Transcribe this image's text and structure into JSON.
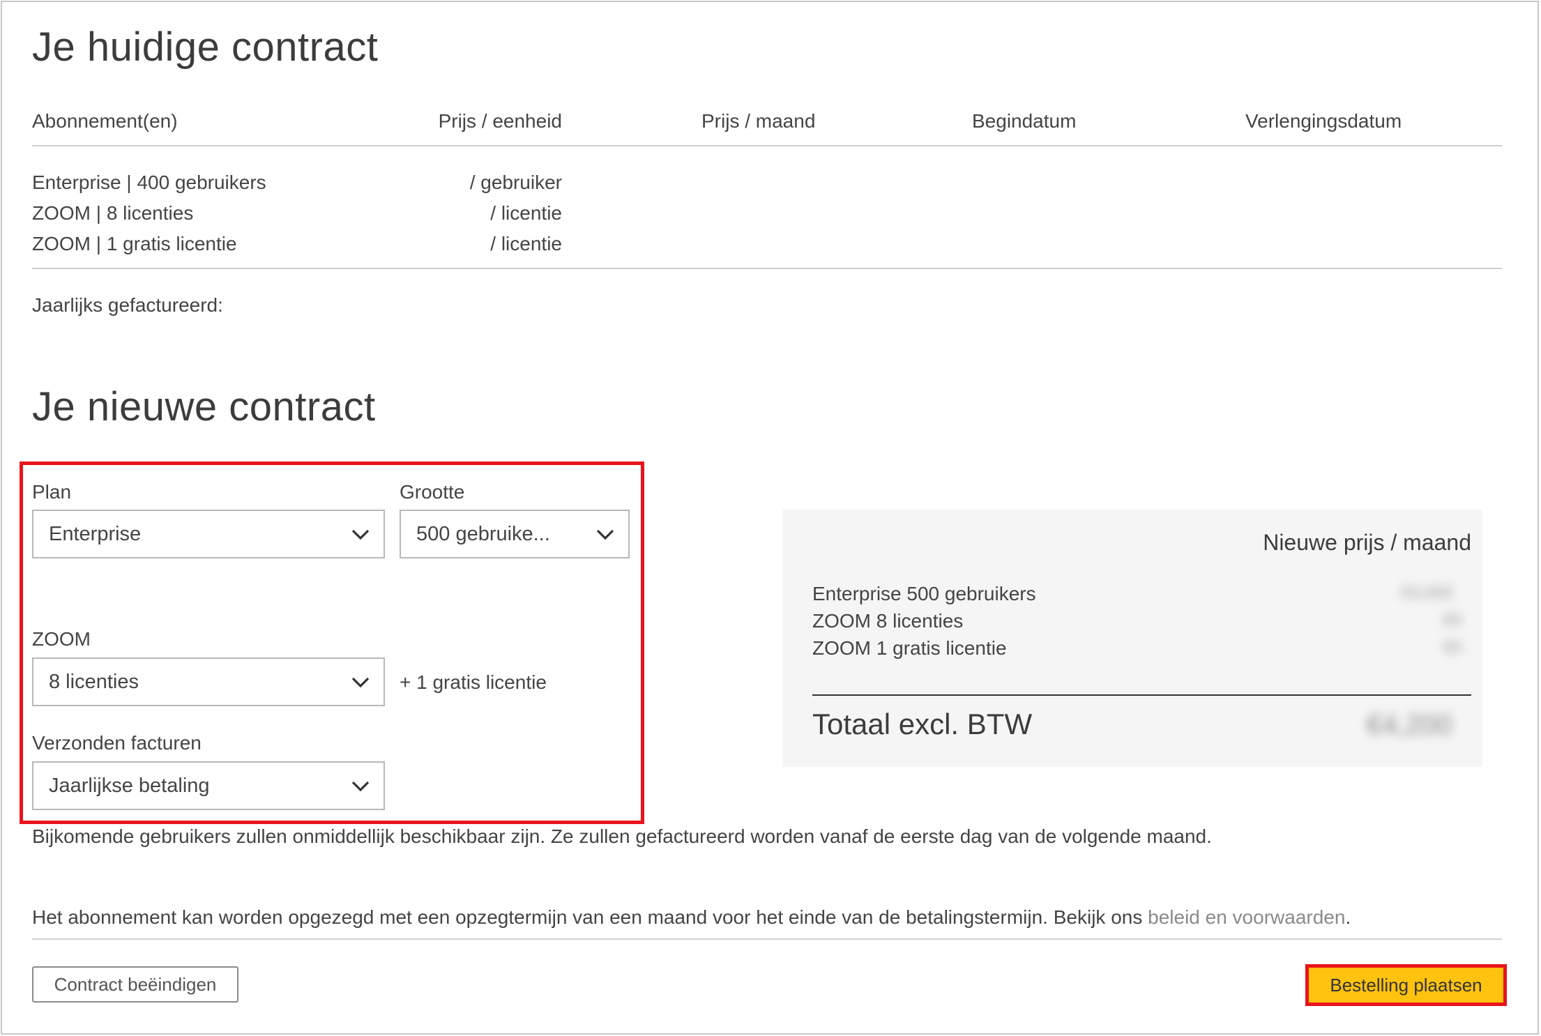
{
  "current": {
    "title": "Je huidige contract",
    "headers": [
      "Abonnement(en)",
      "Prijs / eenheid",
      "Prijs / maand",
      "Begindatum",
      "Verlengingsdatum"
    ],
    "rows": [
      {
        "name": "Enterprise | 400 gebruikers",
        "unit": "/ gebruiker"
      },
      {
        "name": "ZOOM | 8 licenties",
        "unit": "/ licentie"
      },
      {
        "name": "ZOOM | 1 gratis licentie",
        "unit": "/ licentie"
      }
    ],
    "billed_label": "Jaarlijks gefactureerd:"
  },
  "new": {
    "title": "Je nieuwe contract",
    "plan": {
      "label": "Plan",
      "value": "Enterprise"
    },
    "size": {
      "label": "Grootte",
      "value": "500 gebruike..."
    },
    "zoom": {
      "label": "ZOOM",
      "value": "8 licenties",
      "extra": "+ 1 gratis licentie"
    },
    "invoices": {
      "label": "Verzonden facturen",
      "value": "Jaarlijkse betaling"
    }
  },
  "summary": {
    "heading": "Nieuwe prijs / maand",
    "items": [
      {
        "label": "Enterprise 500 gebruikers",
        "value": "€4,000"
      },
      {
        "label": "ZOOM 8 licenties",
        "value": "€0"
      },
      {
        "label": "ZOOM 1 gratis licentie",
        "value": "€0"
      }
    ],
    "total_label": "Totaal excl. BTW",
    "total_value": "€4,200"
  },
  "notes": {
    "additional": "Bijkomende gebruikers zullen onmiddellijk beschikbaar zijn. Ze zullen gefactureerd worden vanaf de eerste dag van de volgende maand.",
    "cancel_text": "Het abonnement kan worden opgezegd met een opzegtermijn van een maand voor het einde van de betalingstermijn. Bekijk ons ",
    "policy_link": "beleid en voorwaarden",
    "period": "."
  },
  "actions": {
    "end_contract": "Contract beëindigen",
    "place_order": "Bestelling plaatsen"
  },
  "colors": {
    "highlight": "#e8141c",
    "primary": "#ffc20e"
  },
  "icons": {
    "dropdown": "chevron-down-icon"
  }
}
